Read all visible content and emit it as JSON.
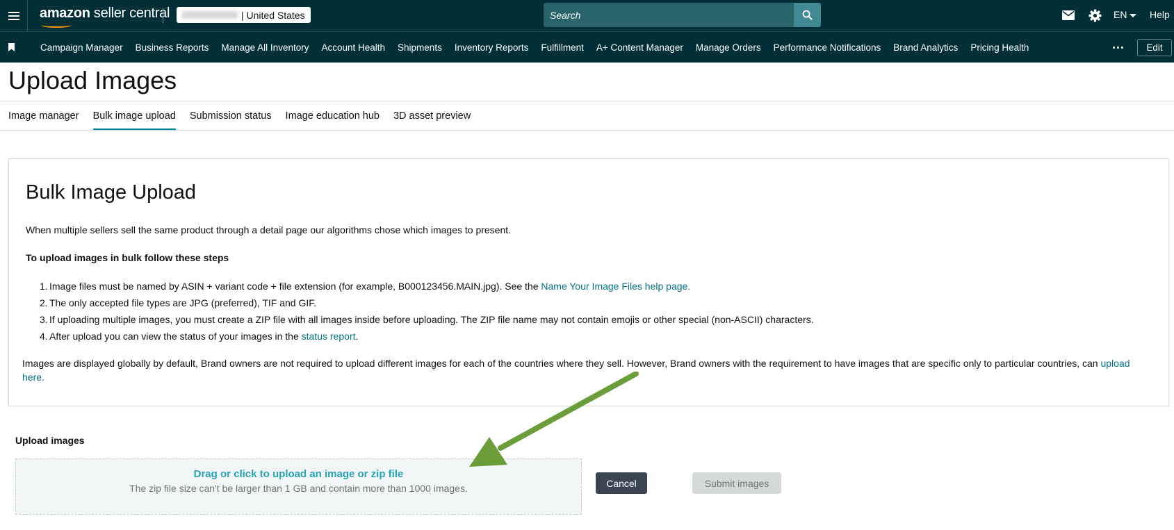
{
  "app": {
    "logo_brand": "amazon",
    "logo_product": " seller central"
  },
  "header": {
    "store_country": "| United States",
    "search_placeholder": "Search",
    "language": "EN",
    "help_label": "Help"
  },
  "nav": {
    "items": [
      "Campaign Manager",
      "Business Reports",
      "Manage All Inventory",
      "Account Health",
      "Shipments",
      "Inventory Reports",
      "Fulfillment",
      "A+ Content Manager",
      "Manage Orders",
      "Performance Notifications",
      "Brand Analytics",
      "Pricing Health"
    ],
    "edit_label": "Edit"
  },
  "page": {
    "title": "Upload Images"
  },
  "tabs": [
    {
      "label": "Image manager",
      "active": false
    },
    {
      "label": "Bulk image upload",
      "active": true
    },
    {
      "label": "Submission status",
      "active": false
    },
    {
      "label": "Image education hub",
      "active": false
    },
    {
      "label": "3D asset preview",
      "active": false
    }
  ],
  "content": {
    "title": "Bulk Image Upload",
    "intro": "When multiple sellers sell the same product through a detail page our algorithms chose which images to present.",
    "steps_heading": "To upload images in bulk follow these steps",
    "steps": [
      {
        "num": "1.",
        "text": "Image files must be named by ASIN + variant code + file extension (for example, B000123456.MAIN.jpg). See the ",
        "link": "Name Your Image Files help page.",
        "after": ""
      },
      {
        "num": "2.",
        "text": "The only accepted file types are JPG (preferred), TIF and GIF.",
        "link": "",
        "after": ""
      },
      {
        "num": "3.",
        "text": "If uploading multiple images, you must create a ZIP file with all images inside before uploading. The ZIP file name may not contain emojis or other special (non-ASCII) characters.",
        "link": "",
        "after": ""
      },
      {
        "num": "4.",
        "text": "After upload you can view the status of your images in the ",
        "link": "status report",
        "after": "."
      }
    ],
    "global_note": "Images are displayed globally by default, Brand owners are not required to upload different images for each of the countries where they sell. However, Brand owners with the requirement to have images that are specific only to particular countries, can ",
    "global_note_link": "upload here."
  },
  "upload": {
    "label": "Upload images",
    "drop_main": "Drag or click to upload an image or zip file",
    "drop_sub": "The zip file size can't be larger than 1 GB and contain more than 1000 images.",
    "cancel_label": "Cancel",
    "submit_label": "Submit images"
  },
  "colors": {
    "header_bg": "#002f36",
    "search_bg": "#27656b",
    "link": "#007185",
    "tab_active": "#008296",
    "annotation_arrow": "#6b9e3a"
  },
  "icons": {
    "menu": "hamburger-icon",
    "search": "search-icon",
    "mail": "mail-icon",
    "settings": "gear-icon",
    "bookmark": "bookmark-icon",
    "more": "more-icon"
  }
}
